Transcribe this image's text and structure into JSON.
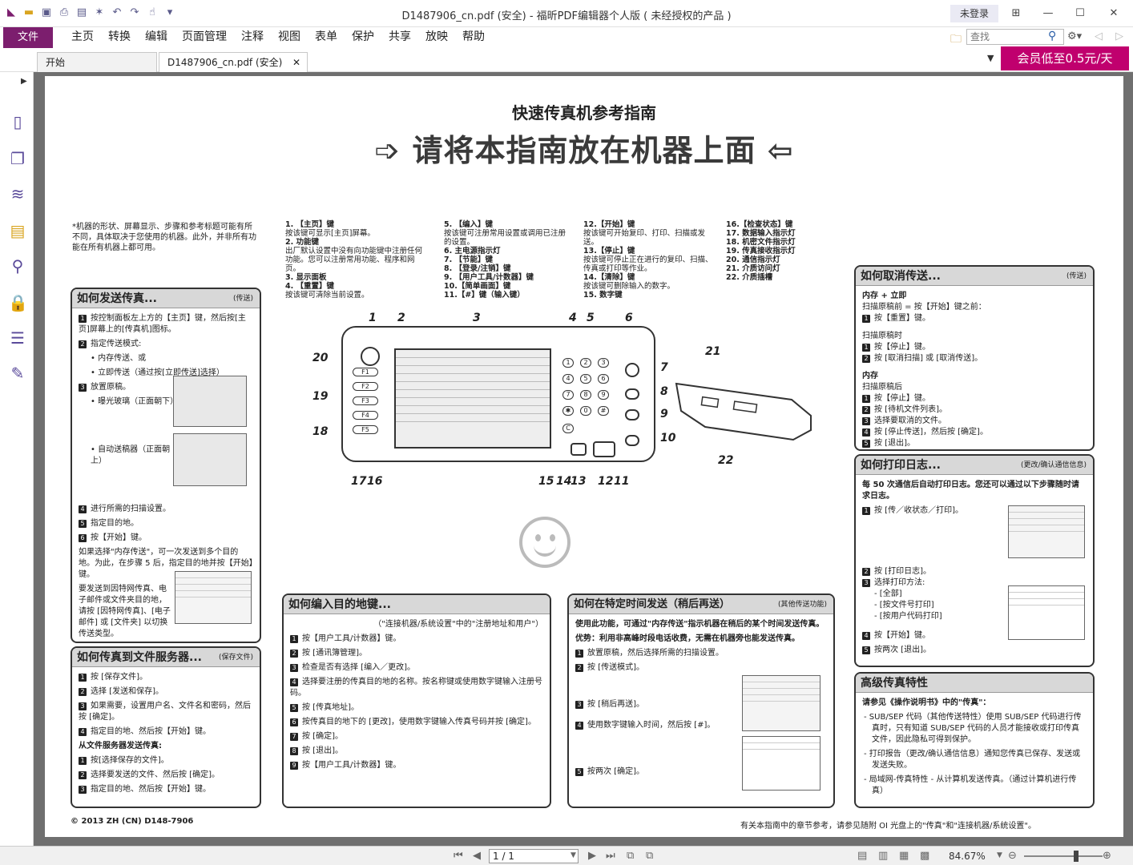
{
  "window": {
    "title": "D1487906_cn.pdf (安全) - 福昕PDF编辑器个人版 ( 未经授权的产品 )",
    "login": "未登录",
    "controls": [
      "⊞",
      "—",
      "☐",
      "✕"
    ]
  },
  "menu": {
    "file": "文件",
    "items": [
      "主页",
      "转换",
      "编辑",
      "页面管理",
      "注释",
      "视图",
      "表单",
      "保护",
      "共享",
      "放映",
      "帮助"
    ],
    "search_placeholder": "查找"
  },
  "tabs": [
    {
      "label": "开始"
    },
    {
      "label": "D1487906_cn.pdf (安全)"
    }
  ],
  "promo": "会员低至0.5元/天",
  "sidebar_icons": [
    "page-thumbnail-icon",
    "pages-icon",
    "layers-icon",
    "comments-icon",
    "attachments-icon",
    "security-icon",
    "form-fields-icon",
    "signature-icon"
  ],
  "status": {
    "page": "1 / 1",
    "zoom": "84.67%"
  },
  "doc": {
    "title": "快速传真机参考指南",
    "banner": "➩ 请将本指南放在机器上面 ⇦",
    "note": "*机器的形状、屏幕显示、步骤和参考标题可能有所不同，具体取决于您使用的机器。此外，并非所有功能在所有机器上都可用。",
    "legend": [
      [
        "1. 【主页】键",
        "按该键可显示[主页]屏幕。",
        "2. 功能键",
        "出厂默认设置中没有向功能键中注册任何功能。您可以注册常用功能、程序和网页。",
        "3. 显示面板",
        "4. 【重置】键",
        "按该键可清除当前设置。"
      ],
      [
        "5. 【编入】键",
        "按该键可注册常用设置或调用已注册的设置。",
        "6. 主电源指示灯",
        "7. 【节能】键",
        "8. 【登录/注销】键",
        "9. 【用户工具/计数器】键",
        "10.【简单画面】键",
        "11.【#】键（输入键）"
      ],
      [
        "12.【开始】键",
        "按该键可开始复印、打印、扫描或发送。",
        "13.【停止】键",
        "按该键可停止正在进行的复印、扫描、传真或打印等作业。",
        "14.【清除】键",
        "按该键可删除输入的数字。",
        "15. 数字键"
      ],
      [
        "16.【检查状态】键",
        "17. 数据输入指示灯",
        "18. 机密文件指示灯",
        "19. 传真接收指示灯",
        "20. 通信指示灯",
        "21. 介质访问灯",
        "22. 介质插槽"
      ]
    ],
    "send": {
      "title": "如何发送传真...",
      "tag": "(传送)",
      "steps": [
        "按控制面板左上方的【主页】键，然后按[主页]屏幕上的[传真机]图标。",
        "指定传送模式:",
        "• 内存传送、或",
        "• 立即传送（通过按[立即传送]选择）",
        "放置原稿。",
        "• 曝光玻璃（正面朝下）",
        "• 自动送稿器（正面朝上）",
        "进行所需的扫描设置。",
        "指定目的地。",
        "按【开始】键。"
      ],
      "extra1": "如果选择\"内存传送\"，可一次发送到多个目的地。为此，在步骤 5 后，指定目的地并按【开始】键。",
      "extra2": "要发送到因特网传真、电子邮件或文件夹目的地，请按 [因特网传真]、[电子邮件] 或 [文件夹] 以切换传送类型。"
    },
    "server": {
      "title": "如何传真到文件服务器...",
      "tag": "(保存文件)",
      "steps": [
        "按 [保存文件]。",
        "选择 [发送和保存]。",
        "如果需要，设置用户名、文件名和密码，然后按 [确定]。",
        "指定目的地、然后按【开始】键。"
      ],
      "sub": "从文件服务器发送传真:",
      "steps2": [
        "按[选择保存的文件]。",
        "选择要发送的文件、然后按 [确定]。",
        "指定目的地、然后按【开始】键。"
      ]
    },
    "program": {
      "title": "如何编入目的地键...",
      "sub": "（\"连接机器/系统设置\"中的\"注册地址和用户\"）",
      "steps": [
        "按【用户工具/计数器】键。",
        "按 [通讯簿管理]。",
        "检查是否有选择 [编入／更改]。",
        "选择要注册的传真目的地的名称。按名称键或使用数字键输入注册号码。",
        "按 [传真地址]。",
        "按传真目的地下的 [更改]，使用数字键输入传真号码并按 [确定]。",
        "按 [确定]。",
        "按 [退出]。",
        "按【用户工具/计数器】键。"
      ]
    },
    "later": {
      "title": "如何在特定时间发送（稍后再送）",
      "tag": "(其他传送功能)",
      "intro": "使用此功能，可通过\"内存传送\"指示机器在稍后的某个时间发送传真。",
      "advantage": "优势：利用非高峰时段电话收费，无需在机器旁也能发送传真。",
      "steps": [
        "放置原稿，然后选择所需的扫描设置。",
        "按 [传送模式]。",
        "按 [稍后再送]。",
        "使用数字键输入时间，然后按 [#]。",
        "按两次 [确定]。"
      ]
    },
    "cancel": {
      "title": "如何取消传送...",
      "tag": "(传送)",
      "b1": "内存 + 立即",
      "b1a": "扫描原稿前 = 按【开始】键之前：",
      "b1s": [
        "按【重置】键。"
      ],
      "b2": "扫描原稿时",
      "b2s": [
        "按【停止】键。",
        "按 [取消扫描] 或 [取消传送]。"
      ],
      "b3": "内存",
      "b3a": "扫描原稿后",
      "b3s": [
        "按【停止】键。",
        "按 [待机文件列表]。",
        "选择要取消的文件。",
        "按 [停止传送]，然后按 [确定]。",
        "按 [退出]。"
      ]
    },
    "log": {
      "title": "如何打印日志...",
      "tag": "(更改/确认通信信息)",
      "intro": "每 50 次通信后自动打印日志。您还可以通过以下步骤随时请求日志。",
      "steps": [
        "按 [传／收状态／打印]。",
        "按 [打印日志]。",
        "选择打印方法:",
        "- [全部]",
        "- [按文件号打印]",
        "- [按用户代码打印]",
        "按【开始】键。",
        "按两次 [退出]。"
      ]
    },
    "adv": {
      "title": "高级传真特性",
      "intro": "请参见《操作说明书》中的\"传真\"：",
      "items": [
        "SUB/SEP 代码（其他传送特性）使用 SUB/SEP 代码进行传真时，只有知道 SUB/SEP 代码的人员才能接收或打印传真文件，因此隐私可得到保护。",
        "打印报告（更改/确认通信信息）通知您传真已保存、发送或发送失败。",
        "局域网-传真特性 - 从计算机发送传真。（通过计算机进行传真）"
      ]
    },
    "footer_left": "© 2013  ZH (CN) D148-7906",
    "footer_right": "有关本指南中的章节参考，请参见随附 OI 光盘上的\"传真\"和\"连接机器/系统设置\"。"
  }
}
